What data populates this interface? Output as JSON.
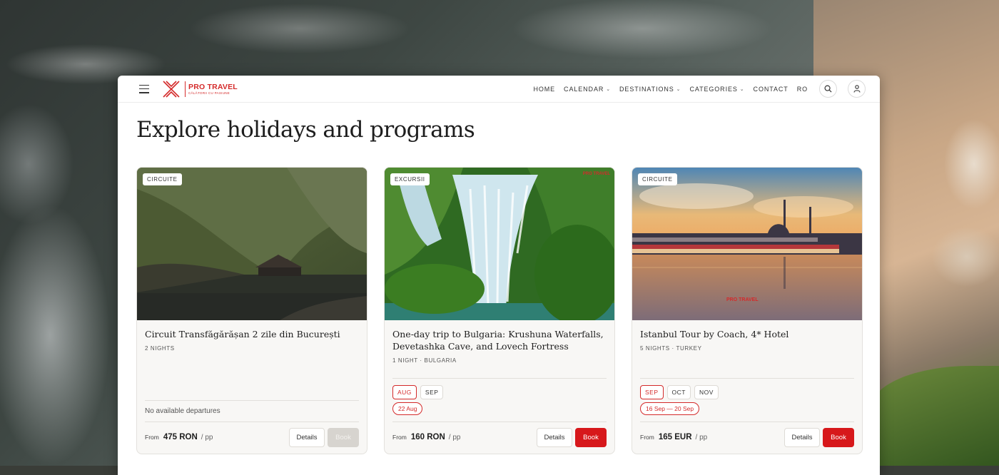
{
  "brand": {
    "name": "PRO TRAVEL",
    "tagline": "CĂLĂTORII CU PASIUNE",
    "color": "#d42a2a"
  },
  "nav": {
    "items": [
      {
        "label": "HOME",
        "has_dropdown": false
      },
      {
        "label": "CALENDAR",
        "has_dropdown": true
      },
      {
        "label": "DESTINATIONS",
        "has_dropdown": true
      },
      {
        "label": "CATEGORIES",
        "has_dropdown": true
      },
      {
        "label": "CONTACT",
        "has_dropdown": false
      },
      {
        "label": "RO",
        "has_dropdown": false
      }
    ],
    "icons": [
      "menu-icon",
      "search-icon",
      "user-icon"
    ]
  },
  "page": {
    "title": "Explore holidays and programs"
  },
  "cards": [
    {
      "category": "CIRCUITE",
      "title": "Circuit Transfăgărășan 2 zile din București",
      "meta": "2 NIGHTS",
      "months": [],
      "dates": [],
      "no_departures": "No available departures",
      "price_from": "From",
      "price": "475 RON",
      "per": "/ pp",
      "details_label": "Details",
      "book_label": "Book",
      "book_enabled": false
    },
    {
      "category": "EXCURSII",
      "title": "One-day trip to Bulgaria: Krushuna Waterfalls, Devetashka Cave, and Lovech Fortress",
      "meta": "1 NIGHT · BULGARIA",
      "watermark": "PRO TRAVEL",
      "months": [
        {
          "label": "AUG",
          "active": true
        },
        {
          "label": "SEP",
          "active": false
        }
      ],
      "dates": [
        "22 Aug"
      ],
      "price_from": "From",
      "price": "160 RON",
      "per": "/ pp",
      "details_label": "Details",
      "book_label": "Book",
      "book_enabled": true
    },
    {
      "category": "CIRCUITE",
      "title": "Istanbul Tour by Coach, 4* Hotel",
      "meta": "5 NIGHTS · TURKEY",
      "watermark": "PRO TRAVEL",
      "months": [
        {
          "label": "SEP",
          "active": true
        },
        {
          "label": "OCT",
          "active": false
        },
        {
          "label": "NOV",
          "active": false
        }
      ],
      "dates": [
        "16 Sep — 20 Sep"
      ],
      "price_from": "From",
      "price": "165 EUR",
      "per": "/ pp",
      "details_label": "Details",
      "book_label": "Book",
      "book_enabled": true
    }
  ]
}
